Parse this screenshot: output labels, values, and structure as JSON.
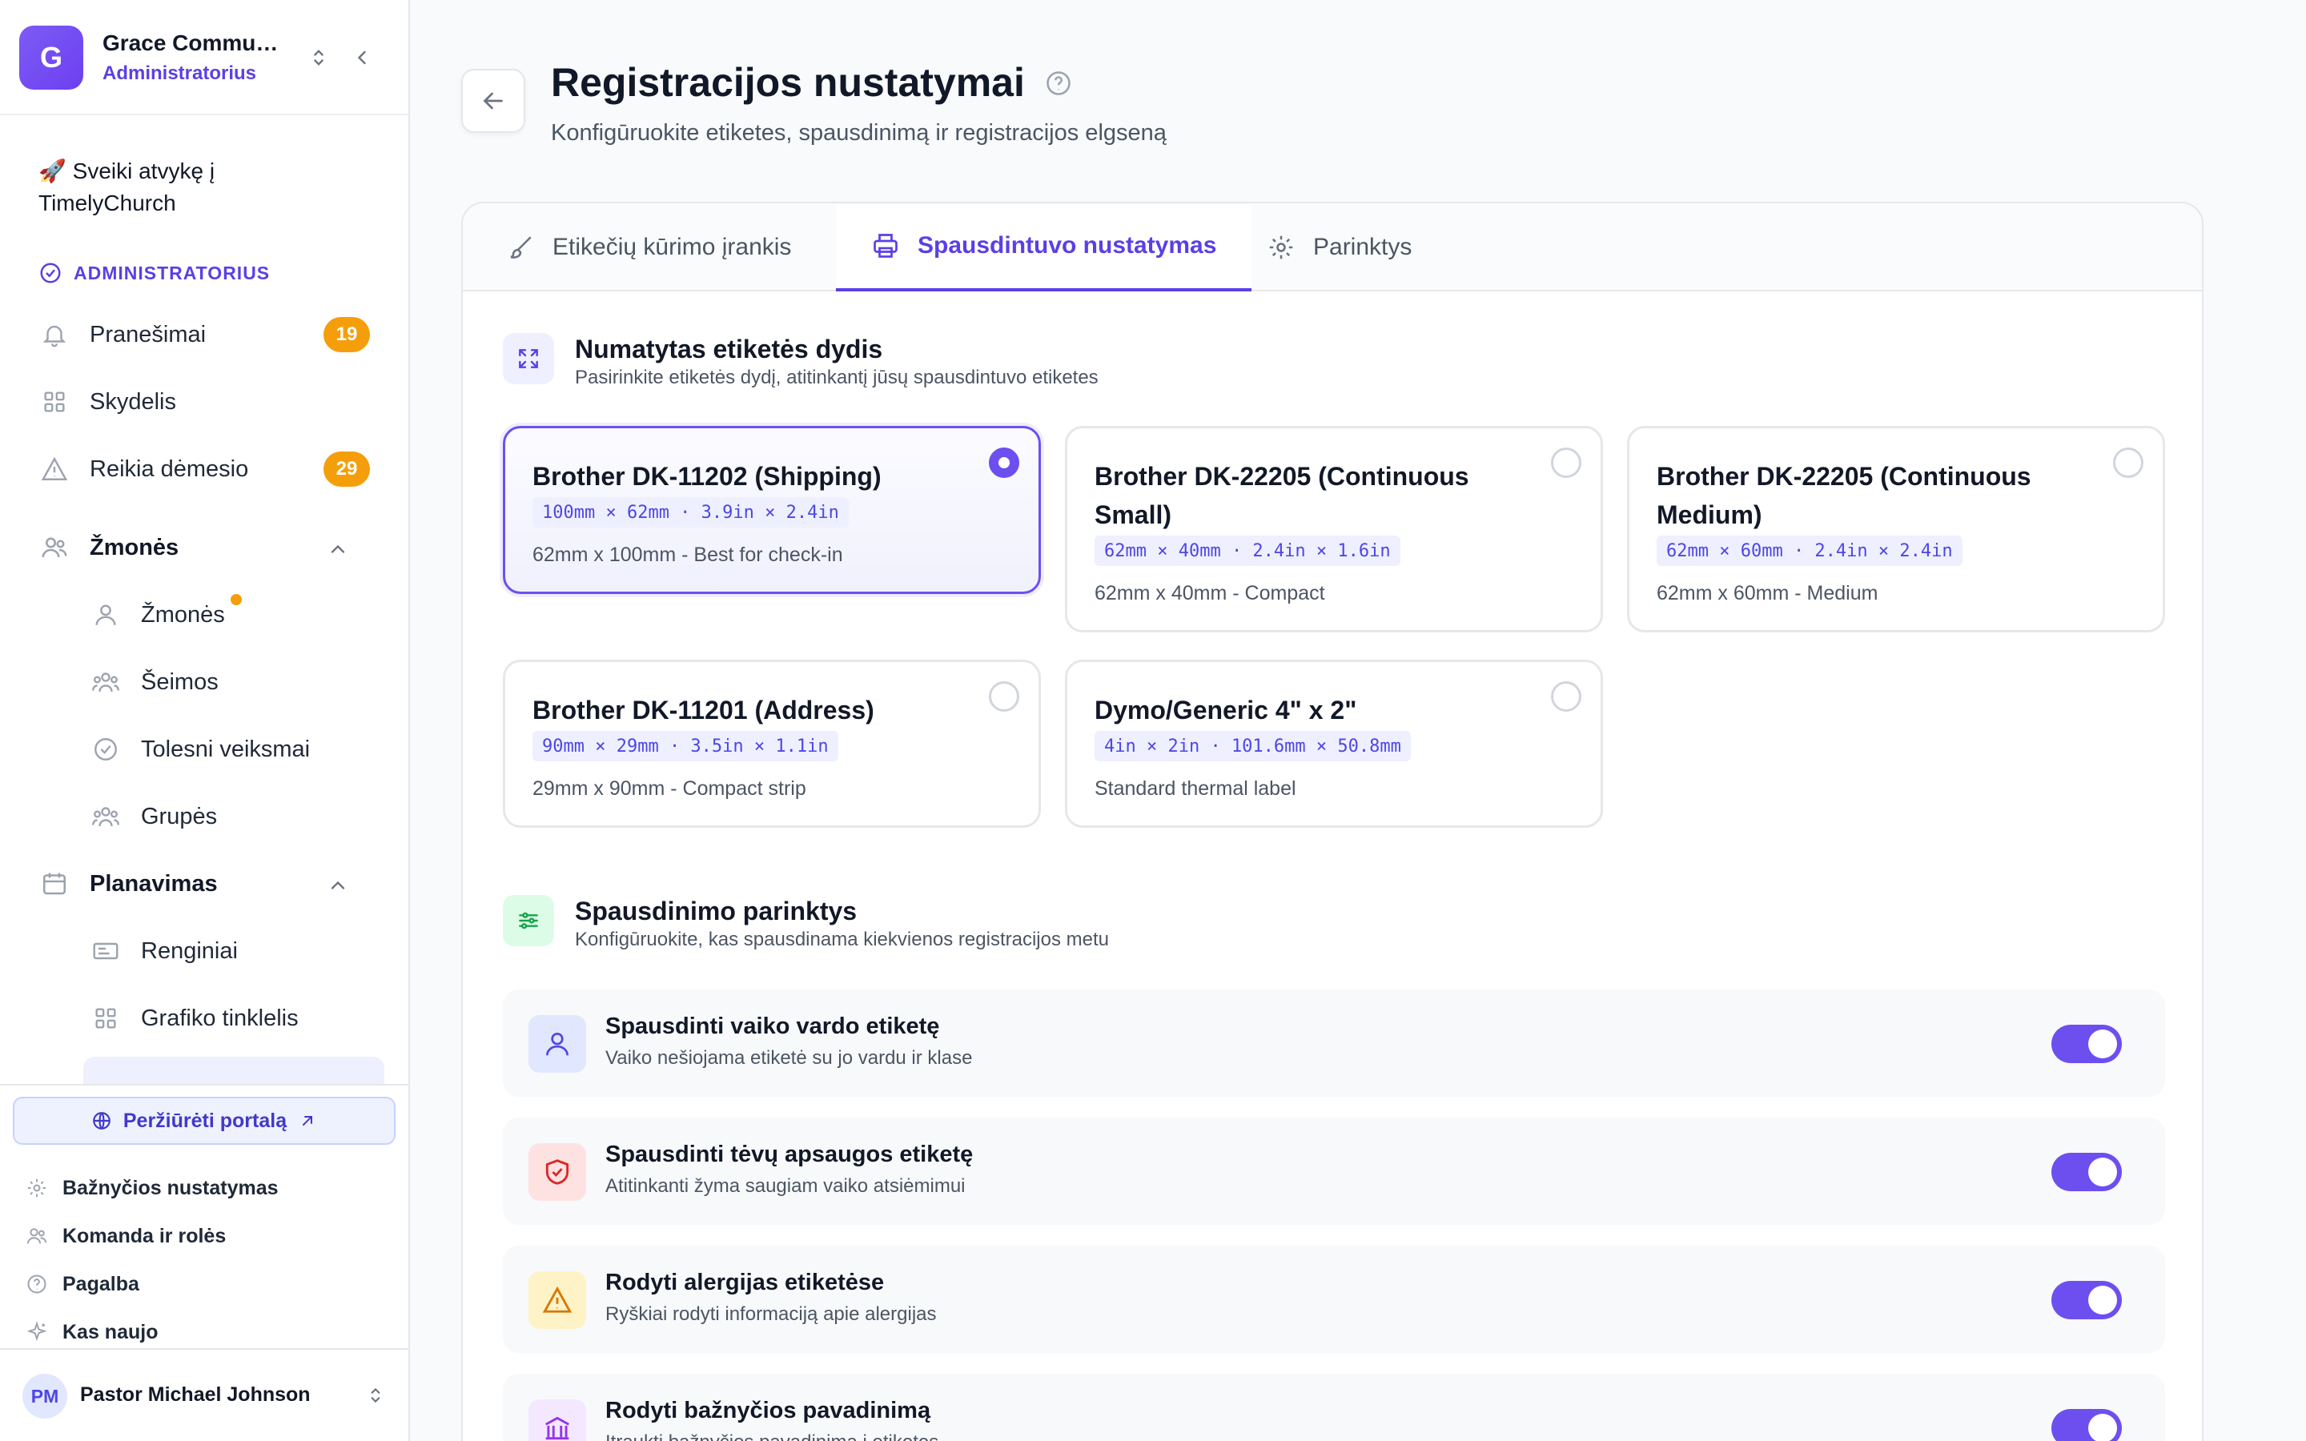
{
  "org": {
    "initial": "G",
    "name": "Grace Community Church",
    "role": "Administratorius"
  },
  "sidebar": {
    "welcome": "🚀 Sveiki atvykę į TimelyChurch",
    "section_label": "ADMINISTRATORIUS",
    "items": [
      {
        "label": "Pranešimai",
        "icon": "bell-icon",
        "badge": "19"
      },
      {
        "label": "Skydelis",
        "icon": "grid-icon"
      },
      {
        "label": "Reikia dėmesio",
        "icon": "warning-icon",
        "badge": "29"
      },
      {
        "label": "Žmonės",
        "icon": "users-icon"
      },
      {
        "label": "Žmonės",
        "icon": "user-icon"
      },
      {
        "label": "Šeimos",
        "icon": "family-icon"
      },
      {
        "label": "Tolesni veiksmai",
        "icon": "check-circle-icon"
      },
      {
        "label": "Grupės",
        "icon": "groups-icon"
      },
      {
        "label": "Planavimas",
        "icon": "calendar-icon"
      },
      {
        "label": "Renginiai",
        "icon": "ticket-icon"
      },
      {
        "label": "Grafiko tinklelis",
        "icon": "grid-icon"
      }
    ],
    "portal_button": "Peržiūrėti portalą",
    "bottom_links": [
      {
        "label": "Bažnyčios nustatymas",
        "icon": "gear-icon"
      },
      {
        "label": "Komanda ir rolės",
        "icon": "users-icon"
      },
      {
        "label": "Pagalba",
        "icon": "help-icon"
      },
      {
        "label": "Kas naujo",
        "icon": "sparkle-icon"
      }
    ],
    "user": {
      "initials": "PM",
      "name": "Pastor Michael Johnson"
    }
  },
  "page": {
    "title": "Registracijos nustatymai",
    "subtitle": "Konfigūruokite etiketes, spausdinimą ir registracijos elgseną"
  },
  "tabs": [
    {
      "label": "Etikečių kūrimo įrankis",
      "icon": "brush-icon"
    },
    {
      "label": "Spausdintuvo nustatymas",
      "icon": "printer-icon"
    },
    {
      "label": "Parinktys",
      "icon": "gear-icon"
    }
  ],
  "label_size": {
    "title": "Numatytas etiketės dydis",
    "description": "Pasirinkite etiketės dydį, atitinkantį jūsų spausdintuvo etiketes",
    "options": [
      {
        "name": "Brother DK-11202 (Shipping)",
        "dims": "100mm × 62mm · 3.9in × 2.4in",
        "desc": "62mm x 100mm - Best for check-in",
        "selected": true
      },
      {
        "name": "Brother DK-22205 (Continuous Small)",
        "dims": "62mm × 40mm · 2.4in × 1.6in",
        "desc": "62mm x 40mm - Compact",
        "selected": false
      },
      {
        "name": "Brother DK-22205 (Continuous Medium)",
        "dims": "62mm × 60mm · 2.4in × 2.4in",
        "desc": "62mm x 60mm - Medium",
        "selected": false
      },
      {
        "name": "Brother DK-11201 (Address)",
        "dims": "90mm × 29mm · 3.5in × 1.1in",
        "desc": "29mm x 90mm - Compact strip",
        "selected": false
      },
      {
        "name": "Dymo/Generic 4\" x 2\"",
        "dims": "4in × 2in · 101.6mm × 50.8mm",
        "desc": "Standard thermal label",
        "selected": false
      }
    ]
  },
  "print_options": {
    "title": "Spausdinimo parinktys",
    "description": "Konfigūruokite, kas spausdinama kiekvienos registracijos metu",
    "rows": [
      {
        "title": "Spausdinti vaiko vardo etiketę",
        "desc": "Vaiko nešiojama etiketė su jo vardu ir klase",
        "enabled": true,
        "icon": "user-icon"
      },
      {
        "title": "Spausdinti tėvų apsaugos etiketę",
        "desc": "Atitinkanti žyma saugiam vaiko atsiėmimui",
        "enabled": true,
        "icon": "shield-icon"
      },
      {
        "title": "Rodyti alergijas etiketėse",
        "desc": "Ryškiai rodyti informaciją apie alergijas",
        "enabled": true,
        "icon": "warning-icon"
      },
      {
        "title": "Rodyti bažnyčios pavadinimą",
        "desc": "Įtraukti bažnyčios pavadinimą į etiketes",
        "enabled": true,
        "icon": "church-icon"
      }
    ]
  },
  "colors": {
    "accent": "#6d4ff0",
    "badge": "#f59e0b",
    "brand": "#7c5cf5"
  }
}
